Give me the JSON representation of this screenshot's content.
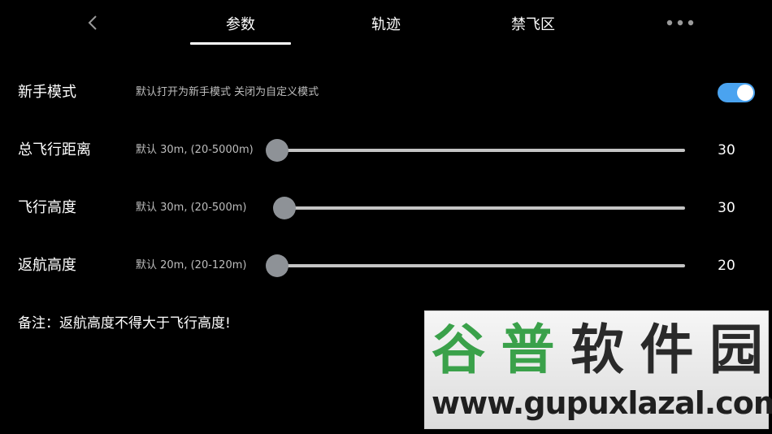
{
  "header": {
    "tabs": [
      {
        "label": "参数",
        "active": true
      },
      {
        "label": "轨迹",
        "active": false
      },
      {
        "label": "禁飞区",
        "active": false
      }
    ]
  },
  "icons": {
    "back": "chevron-left-icon",
    "more": "more-horizontal-icon"
  },
  "settings": {
    "novice_mode": {
      "label": "新手模式",
      "description": "默认打开为新手模式 关闭为自定义模式",
      "enabled": true
    },
    "total_distance": {
      "label": "总飞行距离",
      "description": "默认 30m, (20-5000m)",
      "value": "30",
      "value_number": 30,
      "min": 20,
      "max": 5000
    },
    "flight_altitude": {
      "label": "飞行高度",
      "description": "默认 30m, (20-500m)",
      "value": "30",
      "value_number": 30,
      "min": 20,
      "max": 500
    },
    "return_altitude": {
      "label": "返航高度",
      "description": "默认 20m, (20-120m)",
      "value": "20",
      "value_number": 20,
      "min": 20,
      "max": 120
    }
  },
  "note": "备注：返航高度不得大于飞行高度!",
  "watermark": {
    "chars": [
      "谷",
      "普",
      "软",
      "件",
      "园"
    ],
    "url": "www.gupuxlazal.com"
  },
  "colors": {
    "background": "#000000",
    "toggle_on": "#4aa3f0",
    "slider_thumb": "#8e9297",
    "slider_track": "#c4c4c4",
    "watermark_green": "#3aa14a",
    "watermark_dark": "#2a2a2a"
  }
}
